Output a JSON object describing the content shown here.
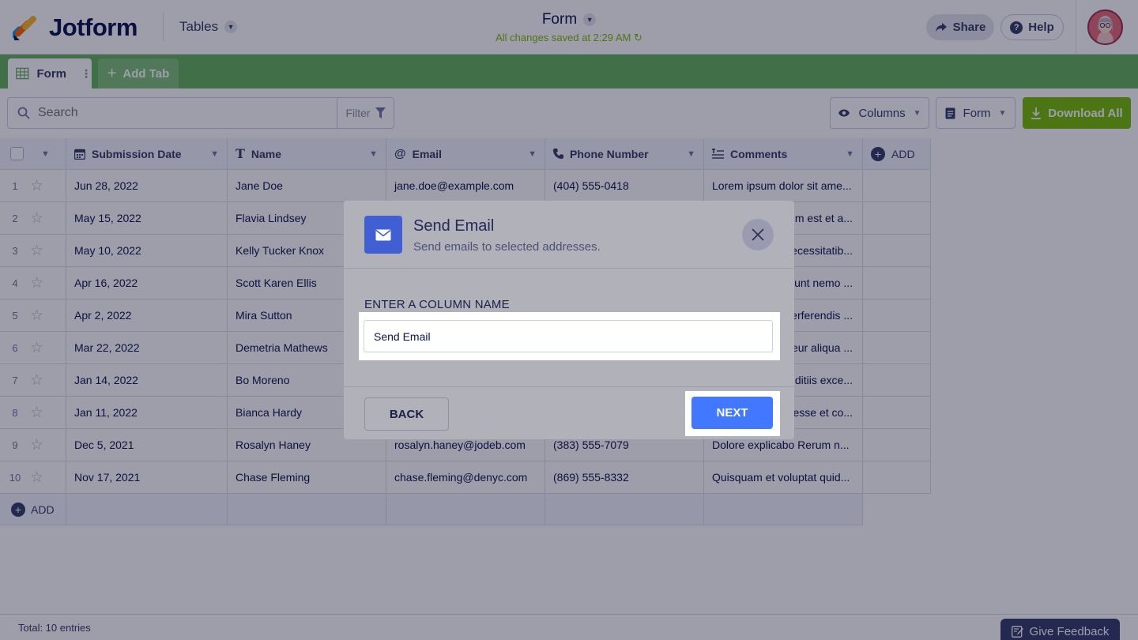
{
  "header": {
    "brand": "Jotform",
    "tables_label": "Tables",
    "doc_title": "Form",
    "save_status": "All changes saved at 2:29 AM",
    "share_label": "Share",
    "help_label": "Help"
  },
  "tabs": {
    "active_label": "Form",
    "add_label": "Add Tab"
  },
  "toolbar": {
    "search_placeholder": "Search",
    "filter_label": "Filter",
    "columns_label": "Columns",
    "view_label": "Form",
    "download_label": "Download All"
  },
  "table": {
    "columns": [
      "Submission Date",
      "Name",
      "Email",
      "Phone Number",
      "Comments"
    ],
    "add_column_label": "ADD",
    "add_row_label": "ADD",
    "rows": [
      {
        "n": "1",
        "date": "Jun 28, 2022",
        "name": "Jane Doe",
        "email": "jane.doe@example.com",
        "phone": "(404) 555-0418",
        "comments": "Lorem ipsum dolor sit ame..."
      },
      {
        "n": "2",
        "date": "May 15, 2022",
        "name": "Flavia Lindsey",
        "email": "",
        "phone": "",
        "comments": "m est et a..."
      },
      {
        "n": "3",
        "date": "May 10, 2022",
        "name": "Kelly Tucker Knox",
        "email": "",
        "phone": "",
        "comments": "ecessitatib..."
      },
      {
        "n": "4",
        "date": "Apr 16, 2022",
        "name": "Scott Karen Ellis",
        "email": "",
        "phone": "",
        "comments": "unt nemo ..."
      },
      {
        "n": "5",
        "date": "Apr 2, 2022",
        "name": "Mira Sutton",
        "email": "",
        "phone": "",
        "comments": "erferendis ..."
      },
      {
        "n": "6",
        "date": "Mar 22, 2022",
        "name": "Demetria Mathews",
        "email": "",
        "phone": "",
        "comments": "eur aliqua ..."
      },
      {
        "n": "7",
        "date": "Jan 14, 2022",
        "name": "Bo Moreno",
        "email": "",
        "phone": "",
        "comments": "ditiis exce..."
      },
      {
        "n": "8",
        "date": "Jan 11, 2022",
        "name": "Bianca Hardy",
        "email": "",
        "phone": "",
        "comments": "esse et co..."
      },
      {
        "n": "9",
        "date": "Dec 5, 2021",
        "name": "Rosalyn Haney",
        "email": "rosalyn.haney@jodeb.com",
        "phone": "(383) 555-7079",
        "comments": "Dolore explicabo Rerum n..."
      },
      {
        "n": "10",
        "date": "Nov 17, 2021",
        "name": "Chase Fleming",
        "email": "chase.fleming@denyc.com",
        "phone": "(869) 555-8332",
        "comments": "Quisquam et voluptat quid..."
      }
    ]
  },
  "footer": {
    "total": "Total: 10 entries",
    "feedback_label": "Give Feedback"
  },
  "modal": {
    "title": "Send Email",
    "subtitle": "Send emails to selected addresses.",
    "field_label": "ENTER A COLUMN NAME",
    "field_value": "Send Email",
    "back_label": "BACK",
    "next_label": "NEXT"
  },
  "colors": {
    "brand_green": "#64b15e",
    "download_green": "#78bb07",
    "primary_blue": "#4277ff",
    "navy": "#0a1551"
  }
}
